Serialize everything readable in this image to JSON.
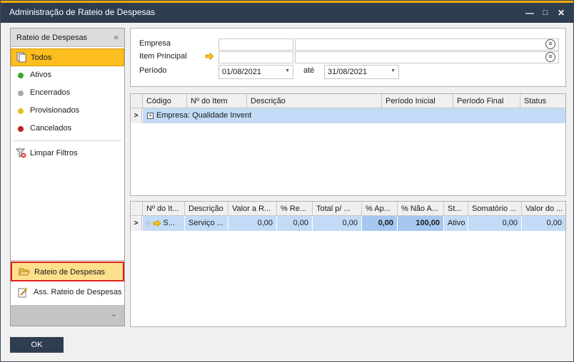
{
  "window": {
    "title": "Administração de Rateio de Despesas"
  },
  "colors": {
    "accent": "#f0ab00",
    "titlebar": "#2f3d51",
    "selected": "#fcbd1e",
    "rowhighlight": "#c3dbf7"
  },
  "leftpanel": {
    "header": "Rateio de Despesas",
    "items": [
      {
        "label": "Todos",
        "icon": "documents-icon"
      },
      {
        "label": "Ativos",
        "color": "#2eab2e"
      },
      {
        "label": "Encerrados",
        "color": "#a9a9a9"
      },
      {
        "label": "Provisionados",
        "color": "#e0c020"
      },
      {
        "label": "Cancelados",
        "color": "#c02020"
      }
    ],
    "clear_filters": "Limpar Filtros",
    "grip": "....",
    "nav": [
      {
        "label": "Rateio de Despesas",
        "icon": "folder-open-icon"
      },
      {
        "label": "Ass. Rateio de Despesas",
        "icon": "wizard-icon"
      }
    ]
  },
  "filters": {
    "empresa_label": "Empresa",
    "item_label": "Item Principal",
    "periodo_label": "Período",
    "date_from": "01/08/2021",
    "ate_label": "até",
    "date_to": "31/08/2021"
  },
  "grid1": {
    "headers": [
      "Código",
      "Nº do Item",
      "Descrição",
      "Período Inicial",
      "Período Final",
      "Status"
    ],
    "group_row": "Empresa: Qualidade Invent"
  },
  "grid2": {
    "headers": [
      "Nº do It...",
      "Descrição",
      "Valor a R...",
      "% Re...",
      "Total p/ ...",
      "% Ap...",
      "% Não A...",
      "St...",
      "Somatório ...",
      "Valor do ..."
    ],
    "row": [
      "S...",
      "Serviço ...",
      "0,00",
      "0,00",
      "0,00",
      "0,00",
      "100,00",
      "Ativo",
      "0,00",
      "0,00"
    ]
  },
  "footer": {
    "ok_label": "OK"
  }
}
